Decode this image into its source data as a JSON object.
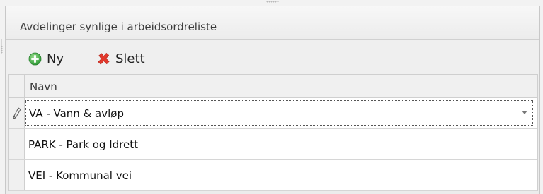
{
  "panel": {
    "title": "Avdelinger synlige i arbeidsordreliste"
  },
  "toolbar": {
    "new_label": "Ny",
    "delete_label": "Slett",
    "new_icon": "add-circle-icon",
    "delete_icon": "delete-x-icon",
    "new_icon_color": "#3fae3f",
    "delete_icon_color": "#e03a2e"
  },
  "grid": {
    "column_header": "Navn",
    "rows": [
      {
        "name": "VA - Vann & avløp",
        "editing": true
      },
      {
        "name": "PARK - Park og Idrett",
        "editing": false
      },
      {
        "name": "VEI - Kommunal vei",
        "editing": false
      }
    ]
  }
}
